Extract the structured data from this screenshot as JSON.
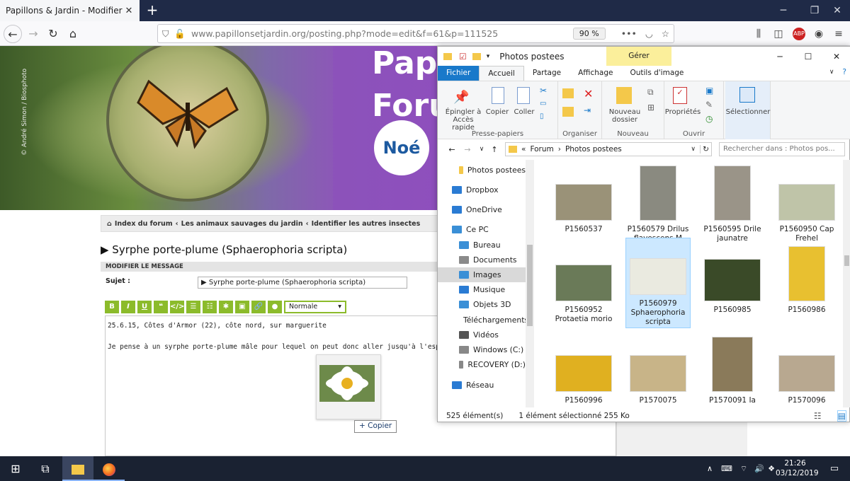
{
  "browser": {
    "tab_title": "Papillons & Jardin - Modifier le mes",
    "tab_close": "✕",
    "new_tab": "+",
    "window_controls": [
      "─",
      "❐",
      "✕"
    ],
    "url_domain": "www.papillonsetjardin.org",
    "url_path": "/posting.php?mode=edit&f=61&p=111525",
    "zoom": "90 %"
  },
  "site": {
    "banner_title_1": "Pap",
    "banner_title_2": "Foru",
    "noe_logo": "Noé",
    "photo_credit": "© André Simon / Biosphoto",
    "breadcrumb": [
      "Index du forum",
      "Les animaux sauvages du jardin",
      "Identifier les autres insectes"
    ],
    "breadcrumb_sep": "‹",
    "post_title": "▶ Syrphe porte-plume (Sphaerophoria scripta)",
    "modify_header": "MODIFIER LE MESSAGE",
    "subject_label": "Sujet :",
    "subject_value": "▶ Syrphe porte-plume (Sphaerophoria scripta)",
    "format_buttons": [
      "B",
      "I",
      "U",
      "❝",
      "</>",
      "☰",
      "☷",
      "✱",
      "▣",
      "🔗",
      "●"
    ],
    "font_select": "Normale",
    "editor_line1": "25.6.15, Côtes d'Armor (22), côte nord, sur marguerite",
    "editor_line2": "Je pense à un syrphe porte-plume mâle pour lequel on peut donc aller jusqu'à l'espèce,  [i]Sp",
    "copy_tooltip": "+ Copier"
  },
  "explorer": {
    "title": "Photos postees",
    "manage_tab": "Gérer",
    "tabs": [
      "Fichier",
      "Accueil",
      "Partage",
      "Affichage",
      "Outils d'image"
    ],
    "ribbon": {
      "pin_label": "Épingler à Accès rapide",
      "copy_label": "Copier",
      "paste_label": "Coller",
      "group_clipboard": "Presse-papiers",
      "group_organize": "Organiser",
      "new_folder": "Nouveau dossier",
      "group_new": "Nouveau",
      "properties": "Propriétés",
      "group_open": "Ouvrir",
      "select": "Sélectionner"
    },
    "address": {
      "prefix": "«",
      "path1": "Forum",
      "sep": "›",
      "path2": "Photos postees"
    },
    "search_placeholder": "Rechercher dans : Photos pos...",
    "nav": [
      "Photos postees",
      "Dropbox",
      "OneDrive",
      "Ce PC",
      "Bureau",
      "Documents",
      "Images",
      "Musique",
      "Objets 3D",
      "Téléchargements",
      "Vidéos",
      "Windows (C:)",
      "RECOVERY (D:)",
      "Réseau"
    ],
    "files": [
      "P1560537",
      "P1560579 Drilus flavescens M",
      "P1560595 Drile jaunatre",
      "P1560950 Cap Frehel",
      "P1560952 Protaetia morio",
      "P1560979 Sphaerophoria scripta",
      "P1560985",
      "P1560986",
      "P1560996",
      "P1570075",
      "P1570091 Ia",
      "P1570096"
    ],
    "status_count": "525 élément(s)",
    "status_selected": "1 élément sélectionné  255 Ko",
    "icon_colors": {
      "folder": "#f4c84a",
      "pc": "#3a8fd6",
      "cloud": "#2a7bd3",
      "accent": "#1979ca"
    }
  },
  "taskbar": {
    "time": "21:26",
    "date": "03/12/2019"
  }
}
